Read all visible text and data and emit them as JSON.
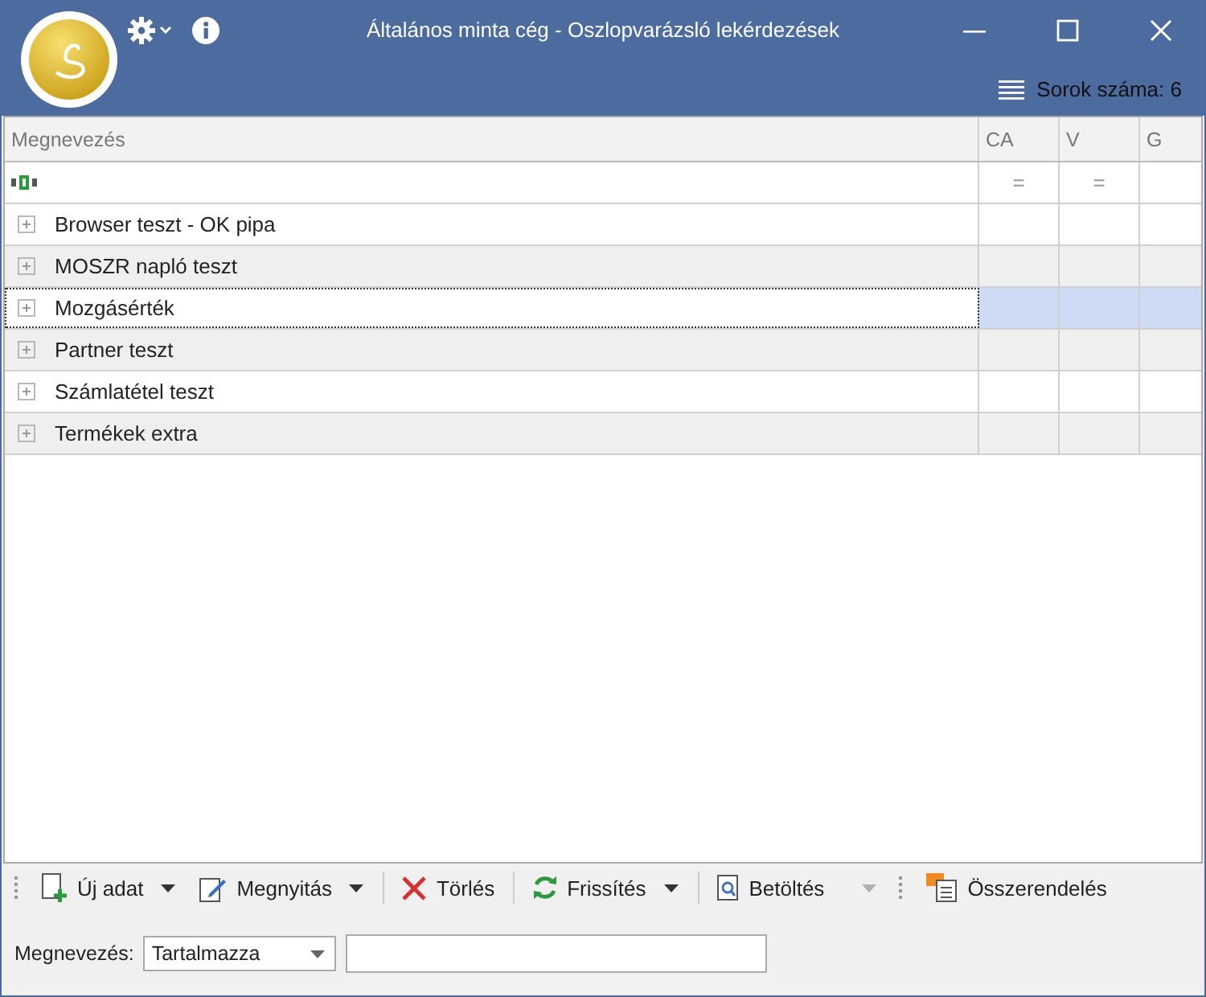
{
  "window": {
    "title": "Általános minta cég - Oszlopvarázsló lekérdezések",
    "row_count": "Sorok száma: 6"
  },
  "table": {
    "columns": [
      {
        "label": "Megnevezés",
        "kind": "text"
      },
      {
        "label": "CA",
        "kind": "number",
        "filter": "="
      },
      {
        "label": "V",
        "kind": "number",
        "filter": "="
      },
      {
        "label": "G",
        "kind": "number"
      }
    ],
    "rows": [
      {
        "label": "Browser teszt - OK pipa",
        "selected": false
      },
      {
        "label": "MOSZR napló teszt",
        "selected": false
      },
      {
        "label": "Mozgásérték",
        "selected": true
      },
      {
        "label": "Partner teszt",
        "selected": false
      },
      {
        "label": "Számlatétel teszt",
        "selected": false
      },
      {
        "label": "Termékek extra",
        "selected": false
      }
    ]
  },
  "toolbar": [
    {
      "kind": "new",
      "label": "Új adat",
      "dropdown": true,
      "dropdown_disabled": false
    },
    {
      "kind": "edit",
      "label": "Megnyitás",
      "dropdown": true,
      "dropdown_disabled": false
    },
    {
      "kind": "delete",
      "label": "Törlés",
      "dropdown": false
    },
    {
      "kind": "refresh",
      "label": "Frissítés",
      "dropdown": true,
      "dropdown_disabled": false
    },
    {
      "kind": "load",
      "label": "Betöltés",
      "dropdown": true,
      "dropdown_disabled": true
    },
    {
      "kind": "assign",
      "label": "Összerendelés",
      "dropdown": false
    }
  ],
  "filter": {
    "label": "Megnevezés:",
    "mode": "Tartalmazza"
  }
}
